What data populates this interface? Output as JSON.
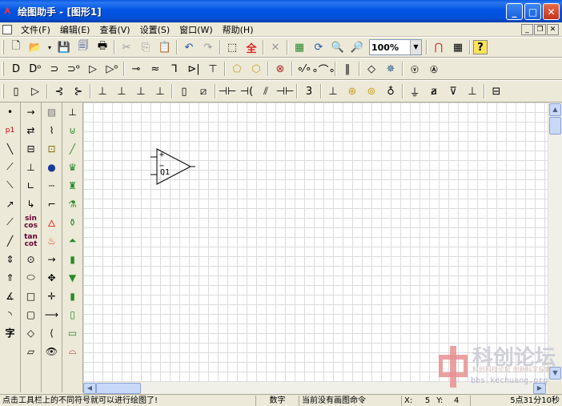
{
  "window": {
    "title": "绘图助手 - [图形1]"
  },
  "menu": {
    "items": [
      "文件(F)",
      "编辑(E)",
      "查看(V)",
      "设置(S)",
      "窗口(W)",
      "帮助(H)"
    ]
  },
  "toolbar": {
    "zoom_value": "100%"
  },
  "canvas": {
    "opamp": {
      "plus_label": "+",
      "minus_label": "−",
      "name_label": "Q1"
    }
  },
  "palette": {
    "p1_label": "p1",
    "sin_label": "sin",
    "cos_label": "cos",
    "tan_label": "tan",
    "cot_label": "cot",
    "char_label": "字"
  },
  "watermark": {
    "title": "科创论坛",
    "subtitle": "科创科技论坛 创新科学探索",
    "url": "bbs.kechuang.org"
  },
  "status": {
    "hint": "点击工具栏上的不同符号就可以进行绘图了!",
    "mode": "数字",
    "command": "当前没有画图命令",
    "x_label": "X:",
    "x_value": "5",
    "y_label": "Y:",
    "y_value": "4",
    "time": "5点31分10秒"
  },
  "colors": {
    "titlebar": "#0054e3",
    "canvas_grid": "#dcdcdc",
    "accent_red": "#e02020"
  }
}
